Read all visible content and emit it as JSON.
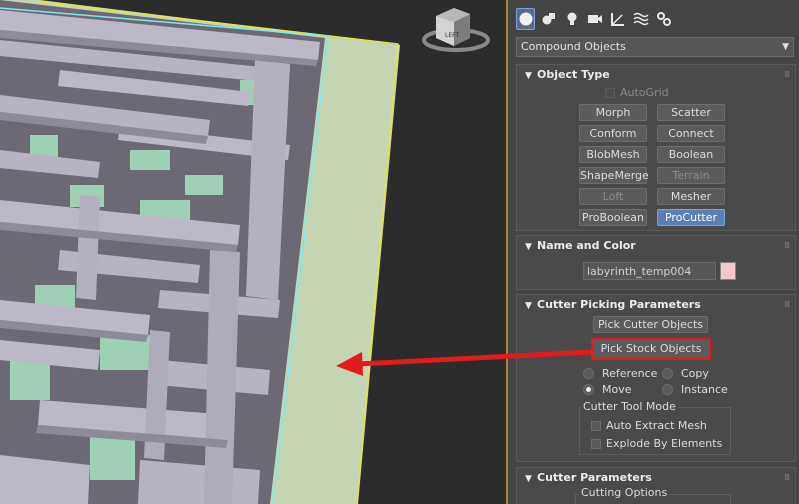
{
  "viewcube": {
    "face_label": "LEFT"
  },
  "panel": {
    "tabs": [
      {
        "name": "create",
        "active": true
      },
      {
        "name": "modify",
        "active": false
      },
      {
        "name": "lights",
        "active": false
      },
      {
        "name": "cameras",
        "active": false
      },
      {
        "name": "helpers",
        "active": false
      },
      {
        "name": "spacewarps",
        "active": false
      },
      {
        "name": "systems",
        "active": false
      }
    ],
    "category": {
      "selected": "Compound Objects"
    }
  },
  "object_type": {
    "title": "Object Type",
    "autogrid_label": "AutoGrid",
    "buttons": [
      {
        "label": "Morph",
        "state": "normal"
      },
      {
        "label": "Scatter",
        "state": "normal"
      },
      {
        "label": "Conform",
        "state": "normal"
      },
      {
        "label": "Connect",
        "state": "normal"
      },
      {
        "label": "BlobMesh",
        "state": "normal"
      },
      {
        "label": "Boolean",
        "state": "normal"
      },
      {
        "label": "ShapeMerge",
        "state": "normal"
      },
      {
        "label": "Terrain",
        "state": "disabled"
      },
      {
        "label": "Loft",
        "state": "disabled"
      },
      {
        "label": "Mesher",
        "state": "normal"
      },
      {
        "label": "ProBoolean",
        "state": "normal"
      },
      {
        "label": "ProCutter",
        "state": "active"
      }
    ]
  },
  "name_color": {
    "title": "Name and Color",
    "name_value": "labyrinth_temp004",
    "swatch_color": "#f2c8c8"
  },
  "cutter_picking": {
    "title": "Cutter Picking Parameters",
    "pick_cutter_label": "Pick Cutter Objects",
    "pick_stock_label": "Pick Stock Objects",
    "radio": {
      "reference": "Reference",
      "copy": "Copy",
      "move": "Move",
      "instance": "Instance"
    },
    "tool_mode": {
      "label": "Cutter Tool Mode",
      "auto_extract": "Auto Extract Mesh",
      "explode": "Explode By Elements"
    }
  },
  "cutter_params": {
    "title": "Cutter Parameters",
    "cutting_options_label": "Cutting Options"
  },
  "colors": {
    "accent": "#5a7fb5",
    "annotation_red": "#e01c1c",
    "panel_bg": "#444444",
    "ground_plane": "#c5d5b4",
    "maze_wall": "#b9b4c4"
  }
}
